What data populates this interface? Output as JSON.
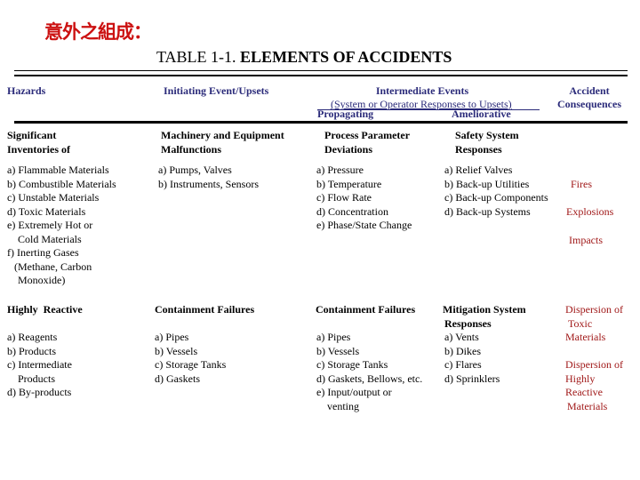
{
  "slide_title": "意外之組成：",
  "table_title": {
    "prefix": "TABLE 1-1. ",
    "main": "ELEMENTS OF ACCIDENTS"
  },
  "headers": {
    "hazards": "Hazards",
    "initiating": "Initiating Event/Upsets",
    "intermediate": "Intermediate Events",
    "intermediate_sub": "(System or Operator Responses to Upsets)",
    "propagating": "Propagating",
    "ameliorative": "Ameliorative",
    "consequences_line1": "Accident",
    "consequences_line2": "Consequences"
  },
  "section1": {
    "hazards": {
      "category": [
        "Significant",
        "Inventories of"
      ],
      "items": [
        "a) Flammable Materials",
        "b) Combustible Materials",
        "c) Unstable Materials",
        "d) Toxic Materials",
        "e) Extremely Hot or",
        "   Cold Materials",
        "f) Inerting Gases",
        "  (Methane, Carbon",
        "   Monoxide)"
      ]
    },
    "initiating": {
      "category": [
        "Machinery and Equipment",
        "Malfunctions"
      ],
      "items": [
        "a) Pumps, Valves",
        "b) Instruments, Sensors"
      ]
    },
    "propagating": {
      "category": [
        "Process Parameter",
        "Deviations"
      ],
      "items": [
        "a) Pressure",
        "b) Temperature",
        "c) Flow Rate",
        "d) Concentration",
        "e) Phase/State Change"
      ]
    },
    "ameliorative": {
      "category": [
        "Safety System",
        "Responses"
      ],
      "items": [
        "a) Relief Valves",
        "b) Back-up Utilities",
        "c) Back-up Components",
        "d) Back-up Systems"
      ]
    },
    "consequences": [
      "Fires",
      "Explosions",
      "Impacts"
    ]
  },
  "section2": {
    "hazards": {
      "category": "Highly  Reactive",
      "items": [
        "a) Reagents",
        "b) Products",
        "c) Intermediate",
        "   Products",
        "d) By-products"
      ]
    },
    "initiating": {
      "category": "Containment Failures",
      "items": [
        "a) Pipes",
        "b) Vessels",
        "c) Storage Tanks",
        "d) Gaskets"
      ]
    },
    "propagating": {
      "category": "Containment Failures",
      "items": [
        "a) Pipes",
        "b) Vessels",
        "c) Storage Tanks",
        "d) Gaskets, Bellows, etc.",
        "e) Input/output or",
        "   venting"
      ]
    },
    "ameliorative": {
      "category": [
        "Mitigation System",
        "Responses"
      ],
      "items": [
        "a) Vents",
        "b) Dikes",
        "c) Flares",
        "d) Sprinklers"
      ]
    },
    "consequences": [
      [
        "Dispersion of",
        "Toxic",
        "Materials"
      ],
      [
        "Dispersion of",
        "Highly",
        "Reactive",
        "Materials"
      ]
    ]
  }
}
